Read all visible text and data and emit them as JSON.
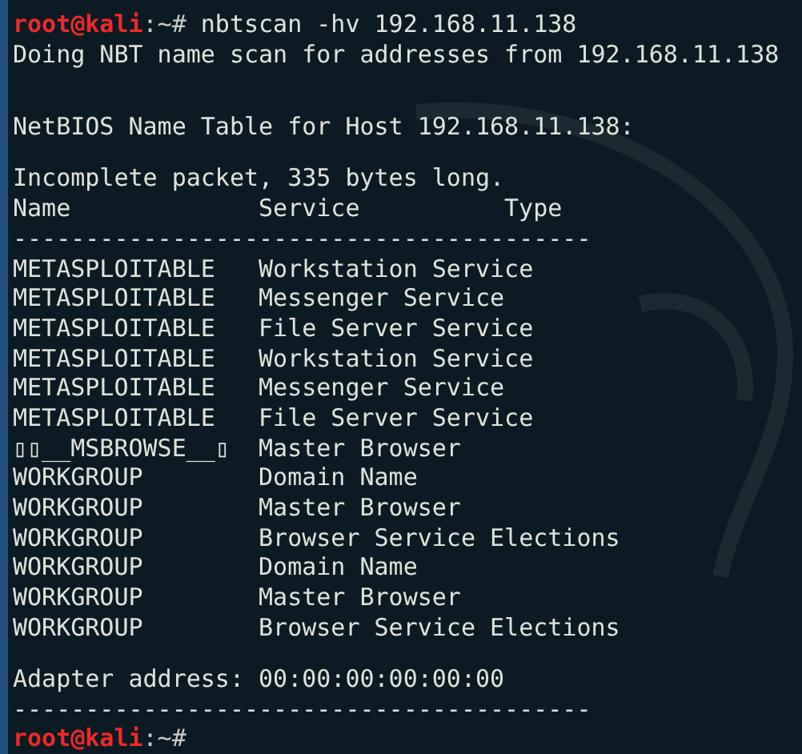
{
  "command_prompt": {
    "user_host": "root@kali",
    "path": ":~#",
    "command": "nbtscan -hv 192.168.11.138"
  },
  "scan_status": "Doing NBT name scan for addresses from 192.168.11.138",
  "table_title": "NetBIOS Name Table for Host 192.168.11.138:",
  "warning": "Incomplete packet, 335 bytes long.",
  "table": {
    "columns": [
      "Name",
      "Service",
      "Type"
    ],
    "rule": "----------------------------------------",
    "rows": [
      {
        "name": "METASPLOITABLE",
        "service": "Workstation Service"
      },
      {
        "name": "METASPLOITABLE",
        "service": "Messenger Service"
      },
      {
        "name": "METASPLOITABLE",
        "service": "File Server Service"
      },
      {
        "name": "METASPLOITABLE",
        "service": "Workstation Service"
      },
      {
        "name": "METASPLOITABLE",
        "service": "Messenger Service"
      },
      {
        "name": "METASPLOITABLE",
        "service": "File Server Service"
      },
      {
        "name": "▯▯__MSBROWSE__▯",
        "service": "Master Browser"
      },
      {
        "name": "WORKGROUP",
        "service": "Domain Name"
      },
      {
        "name": "WORKGROUP",
        "service": "Master Browser"
      },
      {
        "name": "WORKGROUP",
        "service": "Browser Service Elections"
      },
      {
        "name": "WORKGROUP",
        "service": "Domain Name"
      },
      {
        "name": "WORKGROUP",
        "service": "Master Browser"
      },
      {
        "name": "WORKGROUP",
        "service": "Browser Service Elections"
      }
    ]
  },
  "adapter_address": "Adapter address: 00:00:00:00:00:00",
  "closing_rule": "----------------------------------------",
  "final_prompt": {
    "user_host": "root@kali",
    "path": ":~#"
  }
}
